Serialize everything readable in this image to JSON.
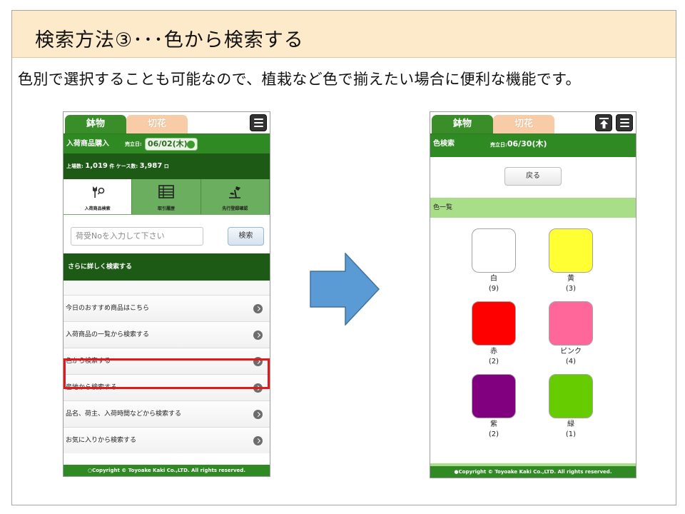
{
  "slide": {
    "title": "検索方法③･･･色から検索する",
    "subtitle": "色別で選択することも可能なので、植栽など色で揃えたい場合に便利な機能です。"
  },
  "left_phone": {
    "tabs": [
      {
        "label": "鉢物",
        "active": true
      },
      {
        "label": "切花",
        "active": false
      }
    ],
    "menu_icon": "menu-icon",
    "header": {
      "title": "入荷商品購入",
      "date_label": "売立日:",
      "date_value": "06/02(木)"
    },
    "stats": {
      "listing_label": "上場数:",
      "listing_value": "1,019",
      "listing_unit": "件",
      "case_label": "ケース数:",
      "case_value": "3,987",
      "case_unit": "ロ"
    },
    "nav": [
      {
        "label": "入荷商品検索",
        "icon": "flower-search-icon",
        "active": true
      },
      {
        "label": "取引履歴",
        "icon": "table-icon",
        "active": false
      },
      {
        "label": "先行登録確認",
        "icon": "plant-icon",
        "active": false
      }
    ],
    "search": {
      "placeholder": "荷受Noを入力して下さい",
      "button": "検索"
    },
    "detail_search_label": "さらに詳しく検索する",
    "menu_items": [
      "今日のおすすめ商品はこちら",
      "入荷商品の一覧から検索する",
      "色から検索する",
      "産地から検索する",
      "品名、荷主、入荷時間などから検索する",
      "お気に入りから検索する"
    ],
    "footer": "○Copyright © Toyoake Kaki Co.,LTD. All rights reserved."
  },
  "right_phone": {
    "tabs": [
      {
        "label": "鉢物",
        "active": true
      },
      {
        "label": "切花",
        "active": false
      }
    ],
    "header": {
      "title": "色検索",
      "date_label": "売立日:",
      "date_value": "06/30(木)"
    },
    "back_button": "戻る",
    "list_title": "色一覧",
    "colors": [
      {
        "name": "白",
        "count": "(9)",
        "hex": "#ffffff"
      },
      {
        "name": "黄",
        "count": "(3)",
        "hex": "#ffff33"
      },
      {
        "name": "赤",
        "count": "(2)",
        "hex": "#ff0000"
      },
      {
        "name": "ピンク",
        "count": "(4)",
        "hex": "#ff6699"
      },
      {
        "name": "紫",
        "count": "(2)",
        "hex": "#800080"
      },
      {
        "name": "緑",
        "count": "(1)",
        "hex": "#66cc00"
      }
    ],
    "footer": "●Copyright © Toyoake Kaki Co.,LTD. All rights reserved."
  },
  "colors": {
    "title_bg": "#fdeacb",
    "green": "#2f8a23",
    "dark_green": "#1c5a15",
    "highlight": "#e0191a",
    "arrow": "#5b9bd5"
  }
}
